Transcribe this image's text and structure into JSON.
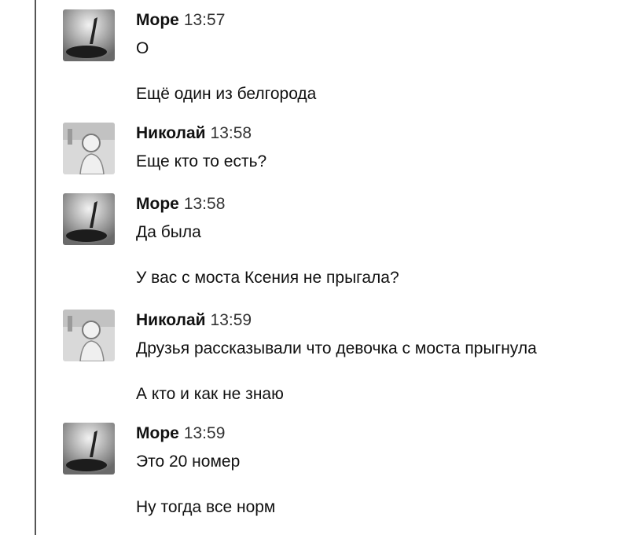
{
  "messages": [
    {
      "author": "Море",
      "time": "13:57",
      "avatar": "sea-avatar",
      "lines": [
        "О",
        "Ещё один из белгорода"
      ]
    },
    {
      "author": "Николай",
      "time": "13:58",
      "avatar": "person-avatar",
      "lines": [
        "Еще кто то есть?"
      ]
    },
    {
      "author": "Море",
      "time": "13:58",
      "avatar": "sea-avatar",
      "lines": [
        "Да была",
        "У вас с моста Ксения не прыгала?"
      ]
    },
    {
      "author": "Николай",
      "time": "13:59",
      "avatar": "person-avatar",
      "lines": [
        "Друзья рассказывали что девочка с моста прыгнула",
        "А кто и как не знаю"
      ]
    },
    {
      "author": "Море",
      "time": "13:59",
      "avatar": "sea-avatar",
      "lines": [
        "Это 20 номер",
        "Ну тогда все норм"
      ]
    }
  ]
}
